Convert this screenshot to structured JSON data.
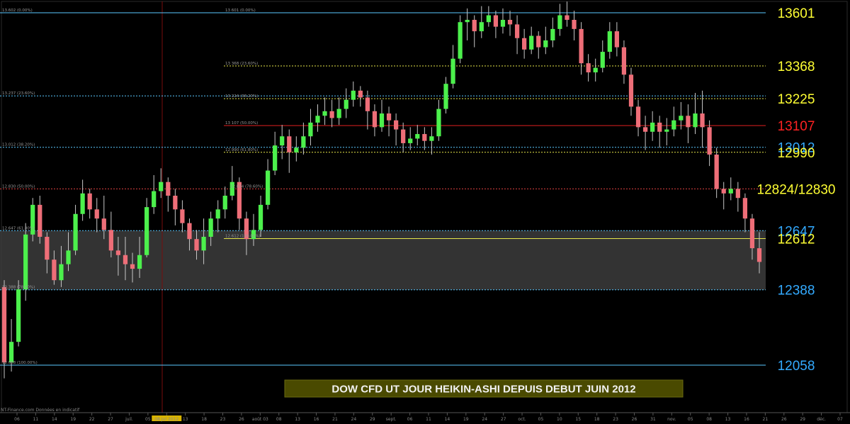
{
  "chart_data": {
    "type": "candlestick",
    "title": "DOW CFD UT JOUR HEIKIN-ASHI DEPUIS DEBUT JUIN 2012",
    "source": "NT-Finance.com   Données en indicatif",
    "ylim": [
      11960,
      13680
    ],
    "grid": false,
    "colors": {
      "background": "#000000",
      "bull": "#4cf04c",
      "bear": "#ee6e78",
      "wick": "#c8c8c8",
      "zone": "#3c3c3c",
      "cursor": "#8a1010",
      "highlight_tick": "#d9b400",
      "title_box": "#4a4a00"
    },
    "levels": [
      {
        "label": "13601",
        "value": 13601,
        "color": "#5ac8ff",
        "label_color": "#ffff33",
        "style": "solid",
        "tag": "13 601 (0.00%)",
        "tag2": "13.602 (0.00%)"
      },
      {
        "label": "13368",
        "value": 13368,
        "color": "#e6e64a",
        "label_color": "#ffff33",
        "style": "dashed",
        "tag": "13 368 (23.60%)",
        "tag2": ""
      },
      {
        "label": "13225",
        "value": 13225,
        "color": "#e6e64a",
        "label_color": "#ffff33",
        "style": "dashed",
        "tag": "13 224 (38.20%)",
        "tag2": ""
      },
      {
        "label": "",
        "value": 13237,
        "color": "#5ac8ff",
        "label_color": "#ffff33",
        "style": "dashed",
        "tag": "",
        "tag2": "13.237 (23.60%)"
      },
      {
        "label": "13107",
        "value": 13107,
        "color": "#e02020",
        "label_color": "#ff2222",
        "style": "solid",
        "tag": "13 107 (50.00%)",
        "tag2": ""
      },
      {
        "label": "13012",
        "value": 13012,
        "color": "#5ac8ff",
        "label_color": "#33aaff",
        "style": "dashed",
        "tag": "",
        "tag2": "13.012 (38.20%)"
      },
      {
        "label": "12990",
        "value": 12990,
        "color": "#e6e64a",
        "label_color": "#ffff33",
        "style": "dashed",
        "tag": "12.990 (61.80%)",
        "tag2": ""
      },
      {
        "label": "12824/12830",
        "value": 12830,
        "color": "#e04040",
        "label_color": "#ffff33",
        "style": "dashed",
        "tag": "12.824 (78.60%)",
        "tag2": "12.830 (50.00%)"
      },
      {
        "label": "12647",
        "value": 12647,
        "color": "#5ac8ff",
        "label_color": "#33aaff",
        "style": "dashed",
        "tag": "",
        "tag2": "12.647 (61.80%)"
      },
      {
        "label": "12612",
        "value": 12612,
        "color": "#e6e64a",
        "label_color": "#ffff33",
        "style": "solid",
        "tag": "12.612 (100.00%)",
        "tag2": ""
      },
      {
        "label": "12388",
        "value": 12388,
        "color": "#5ac8ff",
        "label_color": "#33aaff",
        "style": "dashed",
        "tag": "",
        "tag2": "12.388 (78.60%)"
      },
      {
        "label": "12058",
        "value": 12058,
        "color": "#5ac8ff",
        "label_color": "#33aaff",
        "style": "solid",
        "tag": "",
        "tag2": "12.058 (100.00%)"
      }
    ],
    "zone": {
      "from": 12388,
      "to": 12647
    },
    "x_ticks": [
      "06",
      "11",
      "14",
      "19",
      "22",
      "27",
      "juil.",
      "05",
      "08 Jul 2012",
      "13",
      "18",
      "23",
      "26",
      "août 03",
      "08",
      "13",
      "16",
      "21",
      "24",
      "29",
      "sept.",
      "06",
      "11",
      "14",
      "19",
      "24",
      "27",
      "oct.",
      "05",
      "10",
      "15",
      "18",
      "23",
      "26",
      "31",
      "nov.",
      "05",
      "08",
      "13",
      "16",
      "21",
      "26",
      "29",
      "déc.",
      "07"
    ],
    "highlight_tick": "08 Jul 2012",
    "candles": [
      [
        12400,
        12070,
        12430,
        12000
      ],
      [
        12070,
        12160,
        12260,
        12030
      ],
      [
        12160,
        12390,
        12430,
        12140
      ],
      [
        12390,
        12630,
        12680,
        12340
      ],
      [
        12630,
        12760,
        12790,
        12600
      ],
      [
        12760,
        12620,
        12800,
        12590
      ],
      [
        12620,
        12520,
        12640,
        12460
      ],
      [
        12520,
        12430,
        12560,
        12410
      ],
      [
        12430,
        12500,
        12580,
        12400
      ],
      [
        12500,
        12560,
        12640,
        12470
      ],
      [
        12560,
        12720,
        12760,
        12540
      ],
      [
        12720,
        12810,
        12870,
        12690
      ],
      [
        12810,
        12740,
        12830,
        12700
      ],
      [
        12740,
        12700,
        12790,
        12640
      ],
      [
        12700,
        12650,
        12800,
        12610
      ],
      [
        12650,
        12560,
        12730,
        12530
      ],
      [
        12560,
        12540,
        12620,
        12450
      ],
      [
        12540,
        12500,
        12620,
        12430
      ],
      [
        12500,
        12480,
        12550,
        12420
      ],
      [
        12480,
        12540,
        12620,
        12440
      ],
      [
        12540,
        12750,
        12790,
        12530
      ],
      [
        12750,
        12820,
        12890,
        12720
      ],
      [
        12820,
        12860,
        12920,
        12790
      ],
      [
        12860,
        12800,
        12880,
        12730
      ],
      [
        12800,
        12740,
        12830,
        12670
      ],
      [
        12740,
        12680,
        12780,
        12640
      ],
      [
        12680,
        12610,
        12700,
        12560
      ],
      [
        12610,
        12560,
        12650,
        12520
      ],
      [
        12560,
        12620,
        12700,
        12500
      ],
      [
        12620,
        12700,
        12730,
        12580
      ],
      [
        12700,
        12740,
        12780,
        12640
      ],
      [
        12740,
        12800,
        12840,
        12700
      ],
      [
        12800,
        12860,
        12930,
        12780
      ],
      [
        12860,
        12700,
        12880,
        12650
      ],
      [
        12700,
        12610,
        12730,
        12540
      ],
      [
        12610,
        12650,
        12720,
        12580
      ],
      [
        12650,
        12760,
        12800,
        12620
      ],
      [
        12760,
        12910,
        12960,
        12740
      ],
      [
        12910,
        13020,
        13080,
        12890
      ],
      [
        13020,
        13060,
        13110,
        12960
      ],
      [
        13060,
        12990,
        13090,
        12900
      ],
      [
        12990,
        13010,
        13060,
        12950
      ],
      [
        13010,
        13060,
        13120,
        12980
      ],
      [
        13060,
        13120,
        13180,
        13020
      ],
      [
        13120,
        13150,
        13200,
        13080
      ],
      [
        13150,
        13170,
        13230,
        13110
      ],
      [
        13170,
        13140,
        13220,
        13100
      ],
      [
        13140,
        13180,
        13230,
        13110
      ],
      [
        13180,
        13220,
        13270,
        13140
      ],
      [
        13220,
        13260,
        13300,
        13190
      ],
      [
        13260,
        13230,
        13280,
        13190
      ],
      [
        13230,
        13170,
        13260,
        13090
      ],
      [
        13170,
        13100,
        13200,
        13060
      ],
      [
        13100,
        13160,
        13220,
        13080
      ],
      [
        13160,
        13130,
        13190,
        13060
      ],
      [
        13130,
        13090,
        13160,
        13020
      ],
      [
        13090,
        13030,
        13120,
        12990
      ],
      [
        13030,
        13050,
        13100,
        13000
      ],
      [
        13050,
        13070,
        13110,
        13020
      ],
      [
        13070,
        13040,
        13100,
        13000
      ],
      [
        13040,
        13060,
        13100,
        12980
      ],
      [
        13060,
        13180,
        13220,
        13040
      ],
      [
        13180,
        13290,
        13320,
        13160
      ],
      [
        13290,
        13400,
        13460,
        13270
      ],
      [
        13400,
        13560,
        13590,
        13380
      ],
      [
        13560,
        13570,
        13620,
        13480
      ],
      [
        13570,
        13520,
        13590,
        13450
      ],
      [
        13520,
        13560,
        13630,
        13490
      ],
      [
        13560,
        13590,
        13630,
        13540
      ],
      [
        13590,
        13540,
        13610,
        13490
      ],
      [
        13540,
        13570,
        13620,
        13510
      ],
      [
        13570,
        13550,
        13610,
        13500
      ],
      [
        13550,
        13490,
        13590,
        13420
      ],
      [
        13490,
        13440,
        13530,
        13400
      ],
      [
        13440,
        13500,
        13540,
        13420
      ],
      [
        13500,
        13450,
        13520,
        13400
      ],
      [
        13450,
        13480,
        13540,
        13420
      ],
      [
        13480,
        13530,
        13580,
        13450
      ],
      [
        13530,
        13590,
        13640,
        13500
      ],
      [
        13590,
        13570,
        13650,
        13540
      ],
      [
        13570,
        13530,
        13610,
        13480
      ],
      [
        13530,
        13380,
        13560,
        13330
      ],
      [
        13380,
        13340,
        13420,
        13300
      ],
      [
        13340,
        13360,
        13400,
        13300
      ],
      [
        13360,
        13430,
        13480,
        13340
      ],
      [
        13430,
        13520,
        13560,
        13400
      ],
      [
        13520,
        13450,
        13560,
        13410
      ],
      [
        13450,
        13330,
        13480,
        13290
      ],
      [
        13330,
        13190,
        13360,
        13150
      ],
      [
        13190,
        13100,
        13220,
        13060
      ],
      [
        13100,
        13080,
        13150,
        13000
      ],
      [
        13080,
        13120,
        13170,
        13040
      ],
      [
        13120,
        13080,
        13150,
        13010
      ],
      [
        13080,
        13090,
        13140,
        13020
      ],
      [
        13090,
        13130,
        13190,
        13060
      ],
      [
        13130,
        13150,
        13210,
        13090
      ],
      [
        13150,
        13100,
        13200,
        13030
      ],
      [
        13100,
        13160,
        13250,
        13070
      ],
      [
        13160,
        13100,
        13260,
        13010
      ],
      [
        13100,
        12980,
        13130,
        12930
      ],
      [
        12980,
        12830,
        13010,
        12790
      ],
      [
        12830,
        12810,
        12860,
        12740
      ],
      [
        12810,
        12830,
        12880,
        12780
      ],
      [
        12830,
        12790,
        12860,
        12730
      ],
      [
        12790,
        12700,
        12810,
        12640
      ],
      [
        12700,
        12570,
        12720,
        12520
      ],
      [
        12570,
        12510,
        12640,
        12460
      ]
    ]
  }
}
